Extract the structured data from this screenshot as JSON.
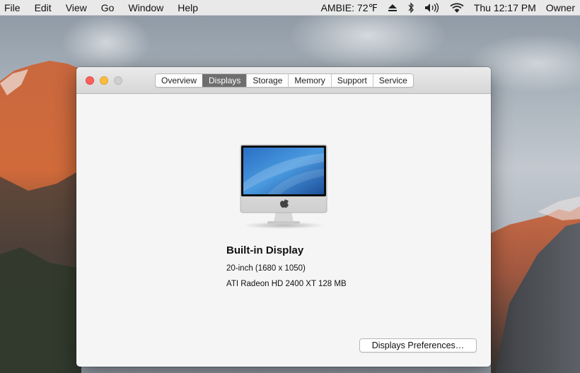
{
  "menubar": {
    "items": [
      "File",
      "Edit",
      "View",
      "Go",
      "Window",
      "Help"
    ],
    "status": {
      "ambie": "AMBIE: 72℉",
      "clock": "Thu 12:17 PM",
      "user": "Owner"
    },
    "icons": [
      "eject-icon",
      "bluetooth-icon",
      "volume-icon",
      "wifi-icon"
    ]
  },
  "window": {
    "tabs": [
      {
        "label": "Overview",
        "active": false
      },
      {
        "label": "Displays",
        "active": true
      },
      {
        "label": "Storage",
        "active": false
      },
      {
        "label": "Memory",
        "active": false
      },
      {
        "label": "Support",
        "active": false
      },
      {
        "label": "Service",
        "active": false
      }
    ],
    "display": {
      "name": "Built-in Display",
      "size": "20-inch (1680 x 1050)",
      "graphics": "ATI Radeon HD 2400 XT 128 MB"
    },
    "preferences_button": "Displays Preferences…"
  },
  "colors": {
    "close": "#fc605b",
    "minimize": "#fdbc40",
    "zoom_inactive": "#cfcfcf",
    "active_tab": "#6e6e6e"
  }
}
